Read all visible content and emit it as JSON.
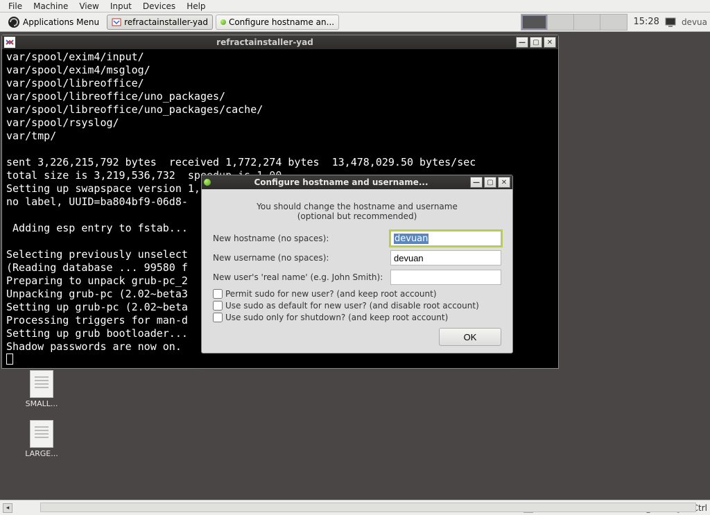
{
  "vbox_menu": [
    "File",
    "Machine",
    "View",
    "Input",
    "Devices",
    "Help"
  ],
  "taskbar": {
    "app_menu": "Applications Menu",
    "tasks": [
      {
        "label": "refractainstaller-yad",
        "highlight": false
      },
      {
        "label": "Configure hostname an...",
        "highlight": true
      }
    ],
    "clock": "15:28",
    "user": "devua"
  },
  "terminal": {
    "title": "refractainstaller-yad",
    "lines": [
      "var/spool/exim4/input/",
      "var/spool/exim4/msglog/",
      "var/spool/libreoffice/",
      "var/spool/libreoffice/uno_packages/",
      "var/spool/libreoffice/uno_packages/cache/",
      "var/spool/rsyslog/",
      "var/tmp/",
      "",
      "sent 3,226,215,792 bytes  received 1,772,274 bytes  13,478,029.50 bytes/sec",
      "total size is 3,219,536,732  speedup is 1.00",
      "Setting up swapspace version 1, size = 954 MiB",
      "no label, UUID=ba804bf9-06d8-",
      "",
      " Adding esp entry to fstab...",
      "",
      "Selecting previously unselect",
      "(Reading database ... 99580 f",
      "Preparing to unpack grub-pc_2",
      "Unpacking grub-pc (2.02~beta3",
      "Setting up grub-pc (2.02~beta",
      "Processing triggers for man-d",
      "Setting up grub bootloader...",
      "Shadow passwords are now on."
    ]
  },
  "dialog": {
    "title": "Configure hostname and username...",
    "message_line1": "You should change the hostname and username",
    "message_line2": "(optional but recommended)",
    "label_hostname": "New hostname (no spaces):",
    "label_username": "New username (no spaces):",
    "label_realname": "New user's 'real name' (e.g. John Smith):",
    "value_hostname": "devuan",
    "value_username": "devuan",
    "value_realname": "",
    "check1": "Permit sudo for new user? (and keep root account)",
    "check2": "Use sudo as default for new user? (and disable root account)",
    "check3": "Use sudo only for shutdown? (and keep root account)",
    "ok": "OK"
  },
  "desktop_icons": {
    "small": "SMALL...",
    "large": "LARGE..."
  },
  "host_status": {
    "key": "Right Ctrl"
  }
}
